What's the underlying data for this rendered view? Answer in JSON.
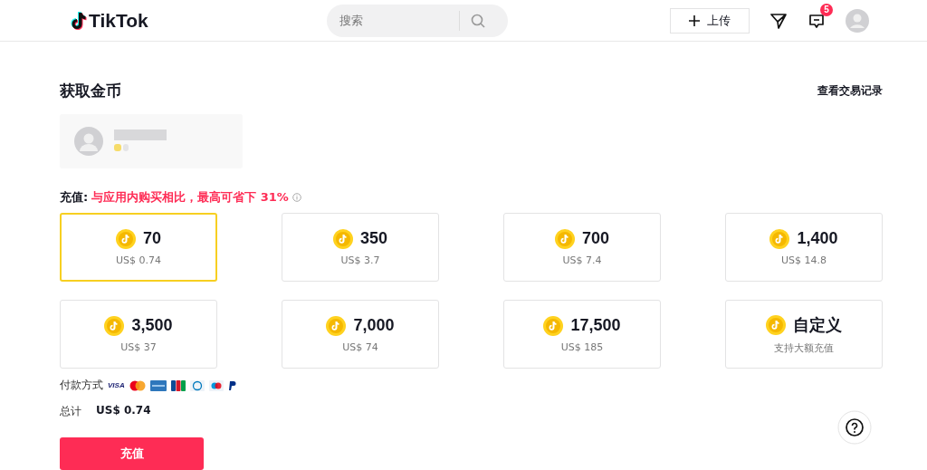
{
  "header": {
    "logo": "TikTok",
    "search": {
      "placeholder": "搜索"
    },
    "upload": "上传",
    "inbox_badge": "5"
  },
  "page": {
    "title": "获取金币",
    "history_link": "查看交易记录",
    "recharge_label": "充值:",
    "promo": "与应用内购买相比，最高可省下 31%"
  },
  "packages": [
    {
      "coins": "70",
      "price": "US$ 0.74",
      "selected": true
    },
    {
      "coins": "350",
      "price": "US$ 3.7",
      "selected": false
    },
    {
      "coins": "700",
      "price": "US$ 7.4",
      "selected": false
    },
    {
      "coins": "1,400",
      "price": "US$ 14.8",
      "selected": false
    },
    {
      "coins": "3,500",
      "price": "US$ 37",
      "selected": false
    },
    {
      "coins": "7,000",
      "price": "US$ 74",
      "selected": false
    },
    {
      "coins": "17,500",
      "price": "US$ 185",
      "selected": false
    },
    {
      "coins": "自定义",
      "price": "支持大额充值",
      "selected": false
    }
  ],
  "payment": {
    "label": "付款方式",
    "methods": [
      {
        "kind": "visa",
        "text": "VISA"
      },
      {
        "kind": "mastercard"
      },
      {
        "kind": "amex"
      },
      {
        "kind": "jcb"
      },
      {
        "kind": "diners"
      },
      {
        "kind": "maestro"
      },
      {
        "kind": "paypal"
      }
    ]
  },
  "total": {
    "label": "总计",
    "amount": "US$ 0.74"
  },
  "submit": "充值"
}
